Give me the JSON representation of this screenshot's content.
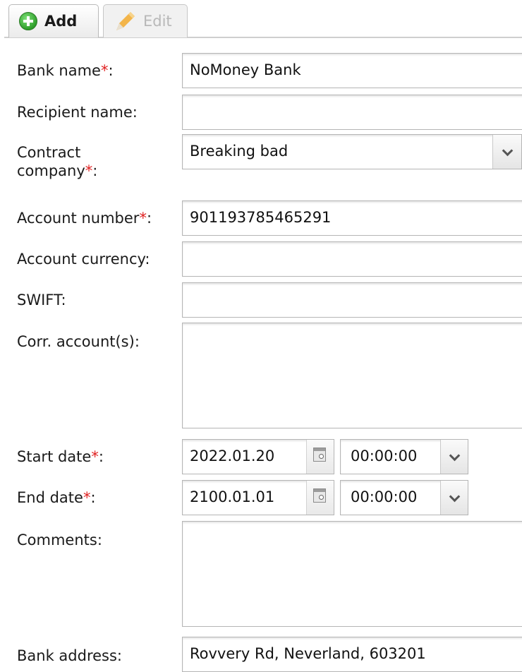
{
  "tabs": {
    "add_label": "Add",
    "edit_label": "Edit"
  },
  "form": {
    "bank_name": {
      "label": "Bank name",
      "required_mark": "*",
      "suffix": ":",
      "value": "NoMoney Bank"
    },
    "recipient_name": {
      "label": "Recipient name:",
      "value": ""
    },
    "contract_company": {
      "label_line1": "Contract",
      "label_line2": "company",
      "required_mark": "*",
      "suffix": ":",
      "value": "Breaking bad"
    },
    "account_number": {
      "label": "Account number",
      "required_mark": "*",
      "suffix": ":",
      "value": "901193785465291"
    },
    "account_currency": {
      "label": "Account currency:",
      "value": ""
    },
    "swift": {
      "label": "SWIFT:",
      "value": ""
    },
    "corr_accounts": {
      "label": "Corr. account(s):",
      "value": ""
    },
    "start_date": {
      "label": "Start date",
      "required_mark": "*",
      "suffix": ":",
      "date": "2022.01.20",
      "time": "00:00:00"
    },
    "end_date": {
      "label": "End date",
      "required_mark": "*",
      "suffix": ":",
      "date": "2100.01.01",
      "time": "00:00:00"
    },
    "comments": {
      "label": "Comments:",
      "value": ""
    },
    "bank_address": {
      "label": "Bank address:",
      "value": "Rovvery Rd, Neverland, 603201"
    }
  },
  "colors": {
    "required": "#e02020",
    "add_icon": "#2f9e2a",
    "edit_icon": "#f0a830"
  },
  "icons": [
    "add-circle-icon",
    "pencil-icon",
    "chevron-down-icon",
    "calendar-icon"
  ]
}
